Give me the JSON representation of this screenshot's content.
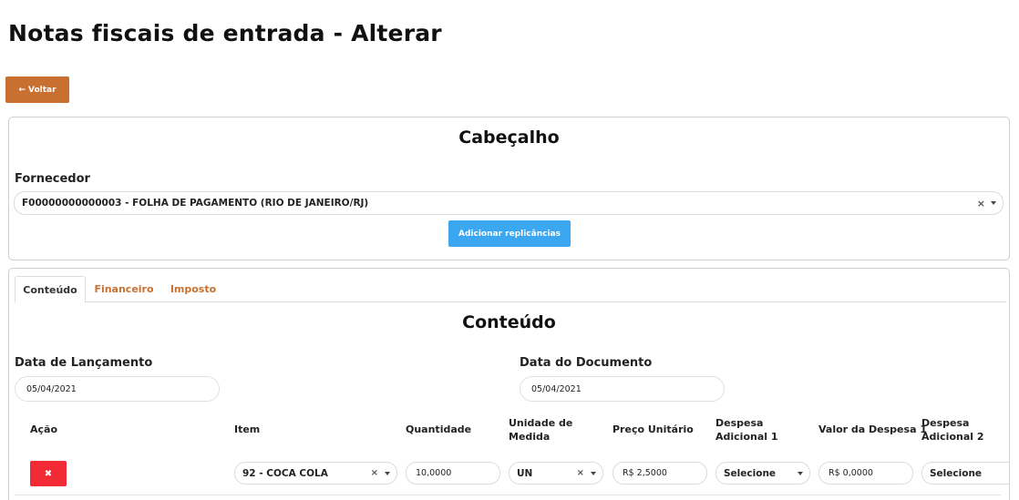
{
  "page": {
    "title": "Notas fiscais de entrada - Alterar"
  },
  "back_button": {
    "icon": "arrow-left-icon",
    "label": "Voltar",
    "color": "#c8702f"
  },
  "header_card": {
    "title": "Cabeçalho",
    "fornecedor_label": "Fornecedor",
    "fornecedor_value": "F00000000000003 - FOLHA DE PAGAMENTO (RIO DE JANEIRO/RJ)",
    "add_button_label": "Adicionar replicâncias",
    "add_button_color": "#3aa7f0"
  },
  "tabs": [
    {
      "label": "Conteúdo",
      "active": true
    },
    {
      "label": "Financeiro",
      "active": false
    },
    {
      "label": "Imposto",
      "active": false
    }
  ],
  "content": {
    "title": "Conteúdo",
    "data_lancamento_label": "Data de Lançamento",
    "data_lancamento_value": "05/04/2021",
    "data_documento_label": "Data do Documento",
    "data_documento_value": "05/04/2021"
  },
  "table": {
    "columns": [
      "Ação",
      "Item",
      "Quantidade",
      "Unidade de Medida",
      "Preço Unitário",
      "Despesa Adicional 1",
      "Valor da Despesa 1",
      "Despesa Adicional 2"
    ],
    "rows": [
      {
        "delete_icon": "times-icon",
        "item": "92 - COCA COLA",
        "quantidade": "10,0000",
        "unidade": "UN",
        "preco_unitario": "R$ 2,5000",
        "despesa_adicional_1": "Selecione",
        "valor_despesa_1": "R$ 0,0000",
        "despesa_adicional_2": "Selecione"
      }
    ]
  },
  "colors": {
    "danger": "#f12a35",
    "accent": "#c8702f"
  }
}
